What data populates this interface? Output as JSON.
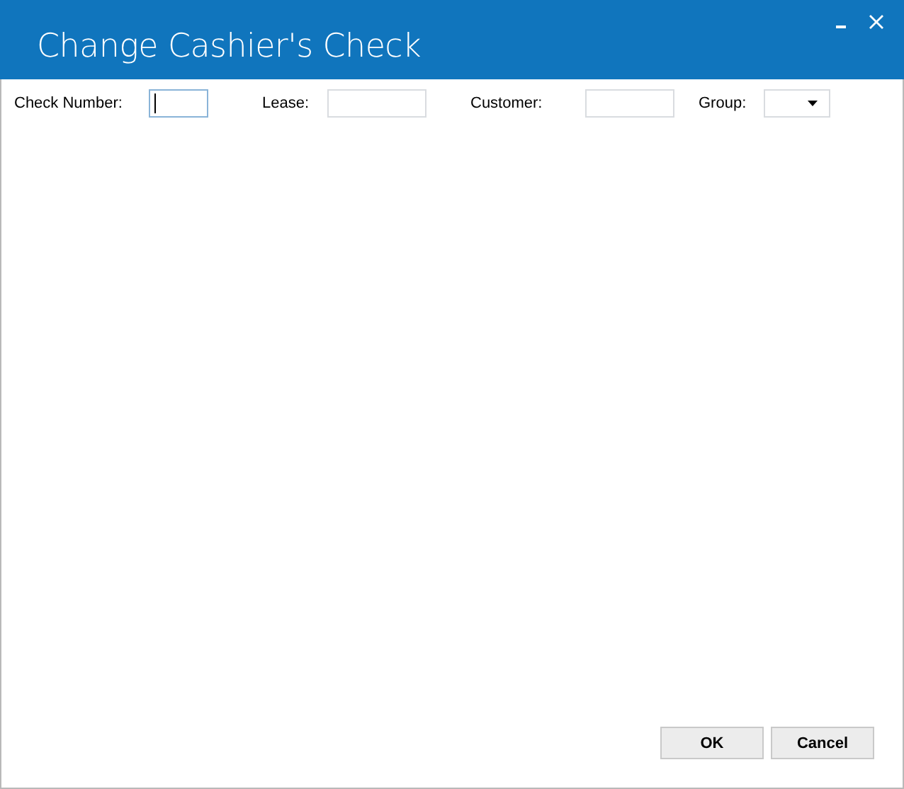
{
  "window": {
    "title": "Change Cashier's Check"
  },
  "fields": [
    {
      "label": "Check Number:",
      "kind": "text",
      "focused": true
    },
    {
      "label": "Lease:",
      "kind": "text",
      "focused": false
    },
    {
      "label": "Customer:",
      "kind": "text",
      "focused": false
    },
    {
      "label": "Group:",
      "kind": "dropdown",
      "focused": false
    }
  ],
  "buttons": [
    "OK",
    "Cancel"
  ]
}
